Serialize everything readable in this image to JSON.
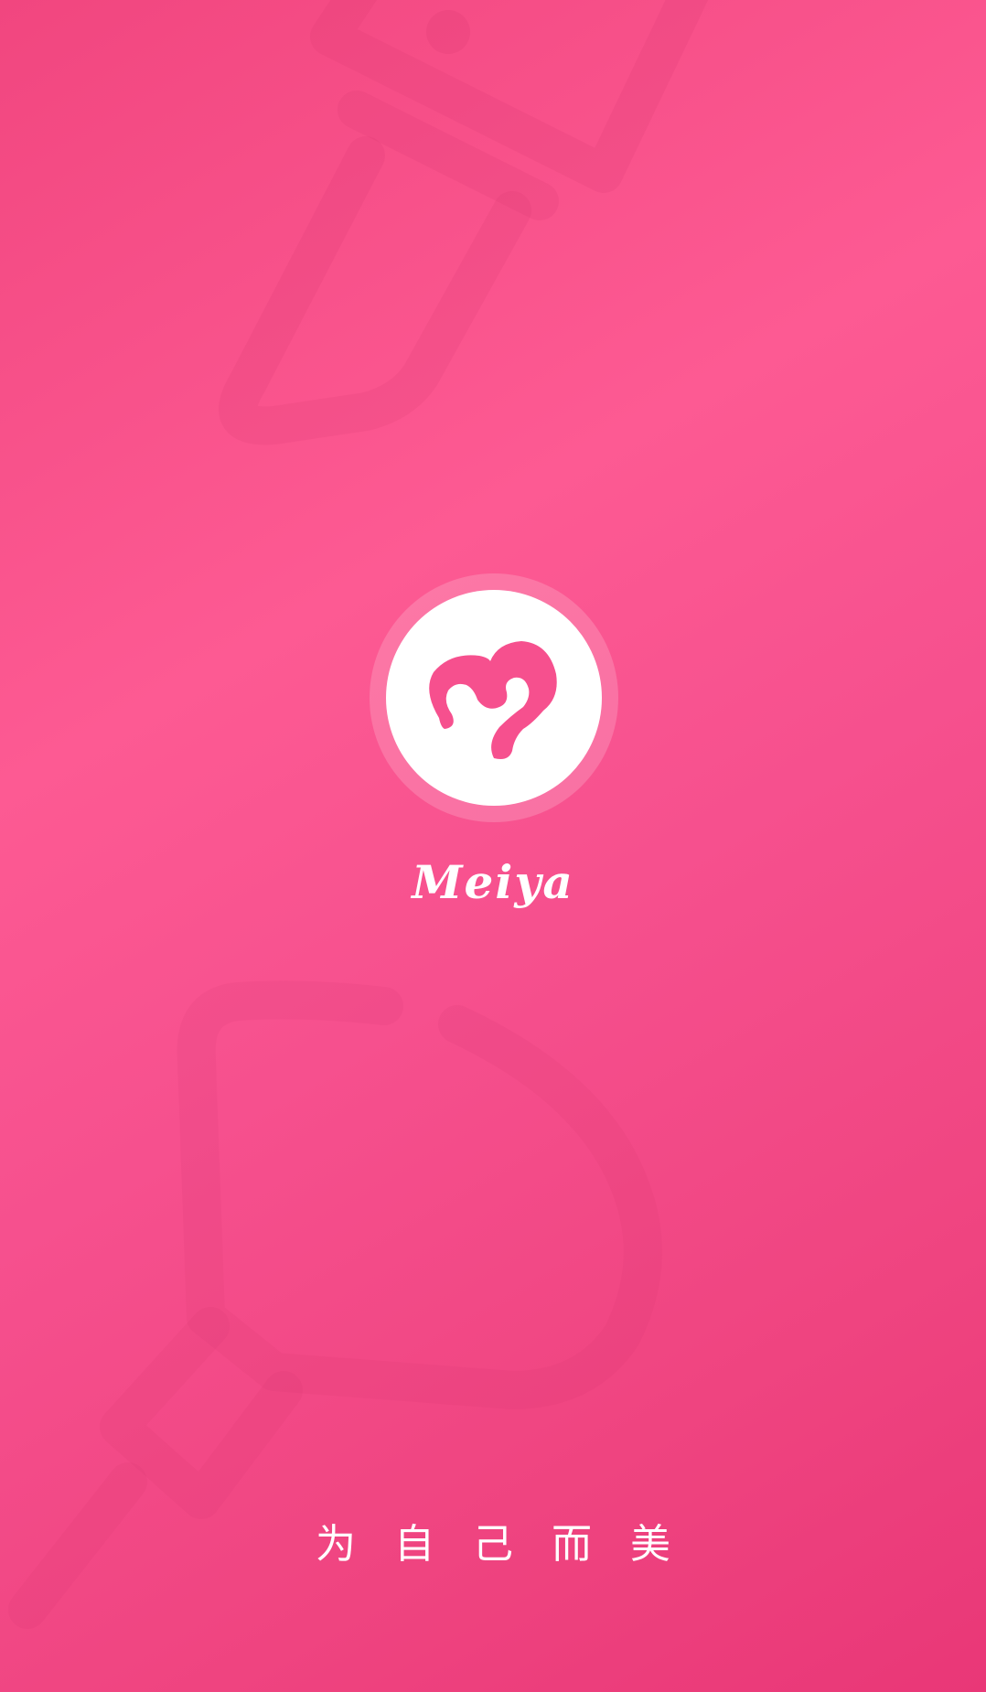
{
  "app": {
    "name": "Meiya",
    "logo_icon": "meiya-swirl-logo-icon",
    "slogan_chars": [
      "为",
      "自",
      "己",
      "而",
      "美"
    ]
  },
  "decorations": {
    "top_icon": "lipstick-icon",
    "bottom_icon": "cosmetic-bottle-icon"
  },
  "colors": {
    "background_start": "#f1467f",
    "background_mid": "#fd5a93",
    "background_end": "#e93777",
    "logo_fill": "#ffffff",
    "logo_mark": "#f6508e"
  }
}
